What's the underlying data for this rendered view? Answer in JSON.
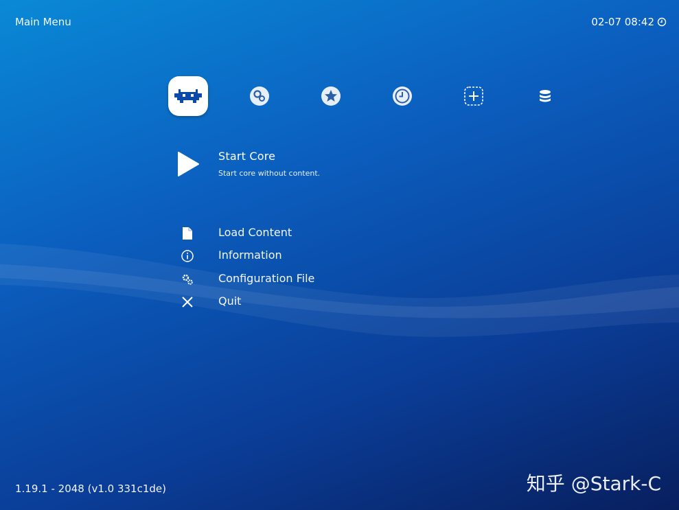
{
  "header": {
    "title": "Main Menu",
    "datetime": "02-07 08:42"
  },
  "tabs": [
    {
      "id": "main-menu",
      "icon": "invader-icon",
      "active": true
    },
    {
      "id": "settings",
      "icon": "gears-icon",
      "active": false
    },
    {
      "id": "favorites",
      "icon": "star-icon",
      "active": false
    },
    {
      "id": "history",
      "icon": "clock-icon",
      "active": false
    },
    {
      "id": "add",
      "icon": "plus-icon",
      "active": false
    },
    {
      "id": "playlists",
      "icon": "database-icon",
      "active": false
    }
  ],
  "selected_item": {
    "label": "Start Core",
    "sublabel": "Start core without content.",
    "icon": "play-icon"
  },
  "menu": {
    "items": [
      {
        "label": "Load Content",
        "icon": "file-icon"
      },
      {
        "label": "Information",
        "icon": "info-icon"
      },
      {
        "label": "Configuration File",
        "icon": "config-gears-icon"
      },
      {
        "label": "Quit",
        "icon": "close-icon"
      }
    ]
  },
  "footer": {
    "version": "1.19.1 - 2048 (v1.0 331c1de)"
  },
  "watermark": {
    "text": "知乎 @Stark-C"
  },
  "colors": {
    "background_top": "#0a89d6",
    "background_bottom": "#081f5e",
    "text": "#ffffff",
    "active_tab": "#ffffff"
  }
}
